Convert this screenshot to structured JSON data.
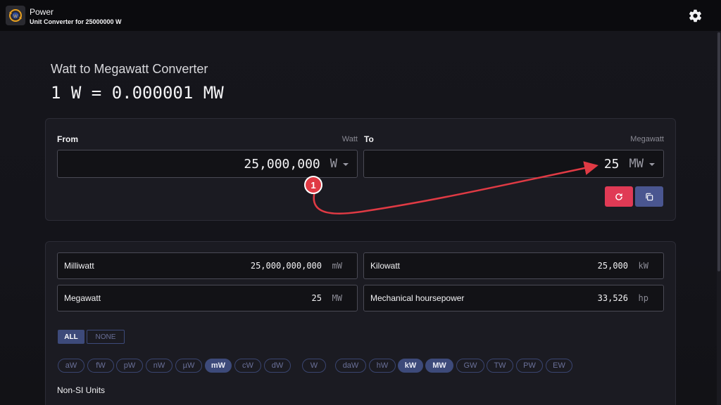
{
  "app": {
    "title": "Power",
    "subtitle": "Unit Converter for 25000000 W"
  },
  "page": {
    "heading": "Watt to Megawatt Converter",
    "formula": "1 W = 0.000001 MW"
  },
  "converter": {
    "from_label": "From",
    "from_unit_name": "Watt",
    "from_value": "25,000,000",
    "from_unit": "W",
    "to_label": "To",
    "to_unit_name": "Megawatt",
    "to_value": "25",
    "to_unit": "MW"
  },
  "results": [
    {
      "name": "Milliwatt",
      "value": "25,000,000,000",
      "unit": "mW"
    },
    {
      "name": "Kilowatt",
      "value": "25,000",
      "unit": "kW"
    },
    {
      "name": "Megawatt",
      "value": "25",
      "unit": "MW"
    },
    {
      "name": "Mechanical hoursepower",
      "value": "33,526",
      "unit": "hp"
    }
  ],
  "filters": {
    "all_label": "ALL",
    "none_label": "NONE"
  },
  "chips": [
    "aW",
    "fW",
    "pW",
    "nW",
    "µW",
    "mW",
    "cW",
    "dW",
    "W",
    "daW",
    "hW",
    "kW",
    "MW",
    "GW",
    "TW",
    "PW",
    "EW"
  ],
  "section": {
    "non_si_label": "Non-SI Units"
  },
  "annotation": {
    "marker": "1"
  },
  "colors": {
    "reset_button": "#e03a55",
    "copy_button": "#4a5690",
    "chip_active": "#3d4a7a",
    "arrow": "#e03a44"
  }
}
